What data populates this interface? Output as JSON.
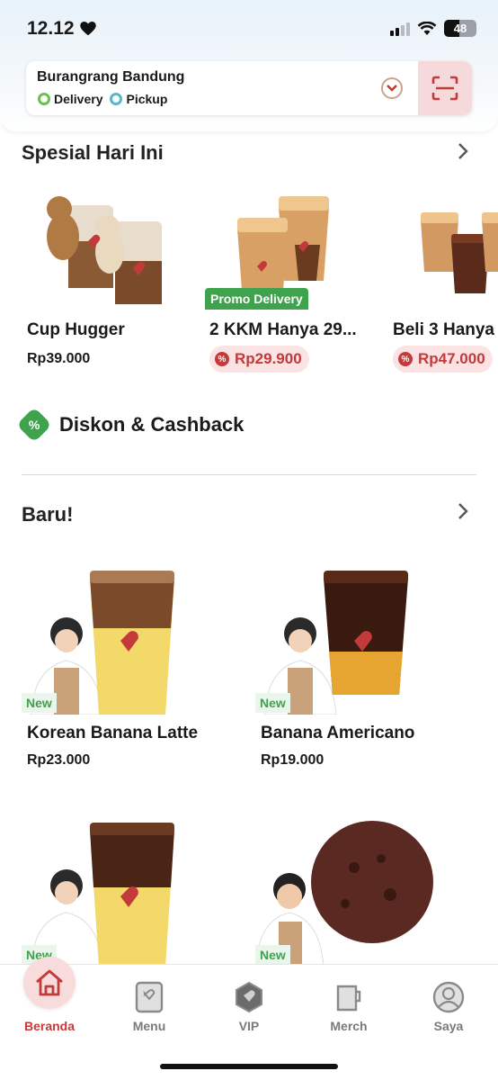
{
  "status_bar": {
    "time": "12.12",
    "battery": "48"
  },
  "store": {
    "name": "Burangrang Bandung",
    "modes": [
      "Delivery",
      "Pickup"
    ]
  },
  "special": {
    "title": "Spesial Hari Ini",
    "items": [
      {
        "name": "Cup Hugger",
        "price": "Rp39.000"
      },
      {
        "name": "2 KKM Hanya 29...",
        "price": "Rp29.900",
        "tag": "Promo Delivery"
      },
      {
        "name": "Beli 3 Hanya",
        "price": "Rp47.000"
      }
    ]
  },
  "diskon": {
    "title": "Diskon & Cashback"
  },
  "new_section": {
    "title": "Baru!",
    "badge": "New",
    "items": [
      {
        "name": "Korean Banana Latte",
        "price": "Rp23.000"
      },
      {
        "name": "Banana Americano",
        "price": "Rp19.000"
      }
    ],
    "partial_badges": [
      "New",
      "New"
    ]
  },
  "nav": {
    "items": [
      {
        "label": "Beranda",
        "icon": "home-icon"
      },
      {
        "label": "Menu",
        "icon": "menu-icon"
      },
      {
        "label": "VIP",
        "icon": "vip-icon"
      },
      {
        "label": "Merch",
        "icon": "merch-icon"
      },
      {
        "label": "Saya",
        "icon": "profile-icon"
      }
    ]
  },
  "colors": {
    "brand_red": "#c23a3a",
    "green": "#3fa34d"
  }
}
